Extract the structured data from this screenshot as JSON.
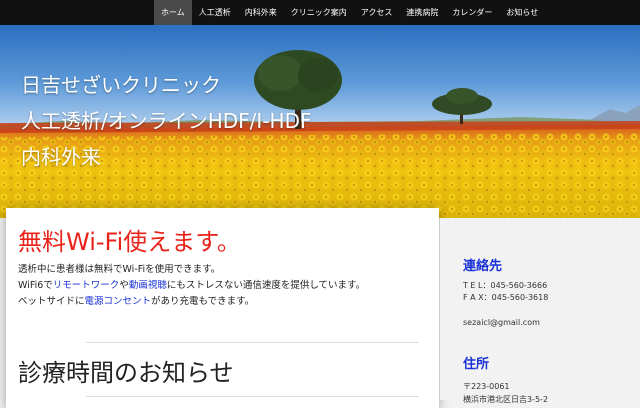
{
  "nav": {
    "items": [
      {
        "label": "ホーム",
        "active": true
      },
      {
        "label": "人工透析",
        "active": false
      },
      {
        "label": "内科外来",
        "active": false
      },
      {
        "label": "クリニック案内",
        "active": false
      },
      {
        "label": "アクセス",
        "active": false
      },
      {
        "label": "連携病院",
        "active": false
      },
      {
        "label": "カレンダー",
        "active": false
      },
      {
        "label": "お知らせ",
        "active": false
      }
    ]
  },
  "hero": {
    "line1": "日吉せざいクリニック",
    "line2": "人工透析/オンラインHDF/I-HDF",
    "line3": "内科外来"
  },
  "main": {
    "wifi_heading": "無料Wi-Fi使えます。",
    "para1": "透析中に患者様は無料でWi-Fiを使用できます。",
    "para2_a": "WiFi6で",
    "para2_link1": "リモートワーク",
    "para2_b": "や",
    "para2_link2": "動画視聴",
    "para2_c": "にもストレスない通信速度を提供しています。",
    "para3_a": "ベットサイドに",
    "para3_link": "電源コンセント",
    "para3_b": "があり充電もできます。",
    "hours_heading": "診療時間のお知らせ"
  },
  "sidebar": {
    "contact_heading": "連絡先",
    "tel": "T E L：045-560-3666",
    "fax": "F A X：045-560-3618",
    "email": "sezaicl@gmail.com",
    "address_heading": "住所",
    "postal": "〒223-0061",
    "address": "横浜市港北区日吉3-5-2"
  },
  "colors": {
    "accent_red": "#e8231a",
    "link_blue": "#1a33d6",
    "nav_bg": "#111111",
    "nav_active": "#4a4a4a"
  }
}
